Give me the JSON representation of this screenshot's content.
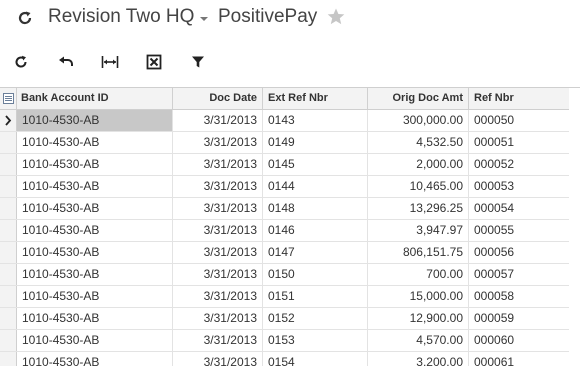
{
  "header": {
    "company": "Revision Two HQ",
    "screen_title": "PositivePay"
  },
  "toolbar": {
    "buttons": [
      {
        "icon": "refresh-icon"
      },
      {
        "icon": "undo-icon"
      },
      {
        "icon": "fit-columns-icon"
      },
      {
        "icon": "export-excel-icon"
      },
      {
        "icon": "filter-icon"
      }
    ]
  },
  "grid": {
    "columns": [
      "Bank Account ID",
      "Doc Date",
      "Ext Ref Nbr",
      "Orig Doc Amt",
      "Ref Nbr"
    ],
    "rows": [
      {
        "bank": "1010-4530-AB",
        "date": "3/31/2013",
        "ext": "0143",
        "amt": "300,000.00",
        "ref": "000050"
      },
      {
        "bank": "1010-4530-AB",
        "date": "3/31/2013",
        "ext": "0149",
        "amt": "4,532.50",
        "ref": "000051"
      },
      {
        "bank": "1010-4530-AB",
        "date": "3/31/2013",
        "ext": "0145",
        "amt": "2,000.00",
        "ref": "000052"
      },
      {
        "bank": "1010-4530-AB",
        "date": "3/31/2013",
        "ext": "0144",
        "amt": "10,465.00",
        "ref": "000053"
      },
      {
        "bank": "1010-4530-AB",
        "date": "3/31/2013",
        "ext": "0148",
        "amt": "13,296.25",
        "ref": "000054"
      },
      {
        "bank": "1010-4530-AB",
        "date": "3/31/2013",
        "ext": "0146",
        "amt": "3,947.97",
        "ref": "000055"
      },
      {
        "bank": "1010-4530-AB",
        "date": "3/31/2013",
        "ext": "0147",
        "amt": "806,151.75",
        "ref": "000056"
      },
      {
        "bank": "1010-4530-AB",
        "date": "3/31/2013",
        "ext": "0150",
        "amt": "700.00",
        "ref": "000057"
      },
      {
        "bank": "1010-4530-AB",
        "date": "3/31/2013",
        "ext": "0151",
        "amt": "15,000.00",
        "ref": "000058"
      },
      {
        "bank": "1010-4530-AB",
        "date": "3/31/2013",
        "ext": "0152",
        "amt": "12,900.00",
        "ref": "000059"
      },
      {
        "bank": "1010-4530-AB",
        "date": "3/31/2013",
        "ext": "0153",
        "amt": "4,570.00",
        "ref": "000060"
      },
      {
        "bank": "1010-4530-AB",
        "date": "3/31/2013",
        "ext": "0154",
        "amt": "3,200.00",
        "ref": "000061"
      }
    ]
  }
}
